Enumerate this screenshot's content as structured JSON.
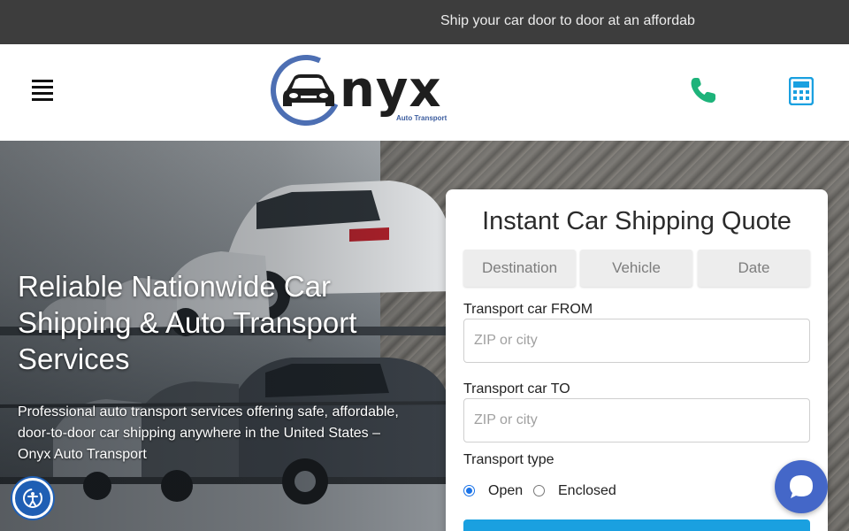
{
  "announcement": {
    "text": "Ship your car door to door at an affordab"
  },
  "header": {
    "logo": {
      "wordmark": "nyx",
      "tagline": "Auto Transport"
    },
    "icons": [
      "menu-icon",
      "phone-icon",
      "calculator-icon"
    ]
  },
  "hero": {
    "title": "Reliable Nationwide Car Shipping & Auto Transport Services",
    "description": "Professional auto transport services offering safe, affordable, door-to-door car shipping anywhere in the United States – Onyx Auto Transport"
  },
  "quote": {
    "title": "Instant Car Shipping Quote",
    "tabs": [
      {
        "label": "Destination"
      },
      {
        "label": "Vehicle"
      },
      {
        "label": "Date"
      }
    ],
    "from": {
      "label": "Transport car FROM",
      "placeholder": "ZIP or city"
    },
    "to": {
      "label": "Transport car TO",
      "placeholder": "ZIP or city"
    },
    "transport_type": {
      "label": "Transport type",
      "options": [
        {
          "label": "Open",
          "selected": true
        },
        {
          "label": "Enclosed",
          "selected": false
        }
      ]
    }
  },
  "colors": {
    "topbar": "#3d3d3d",
    "phone": "#1db37a",
    "calculator": "#1aa0e0",
    "logo_blue": "#4d6fb3",
    "submit": "#1aa0e0",
    "chat": "#4467c8",
    "accessibility": "#1f5fb4"
  },
  "widgets": {
    "accessibility": "accessibility-icon",
    "chat": "chat-icon"
  }
}
